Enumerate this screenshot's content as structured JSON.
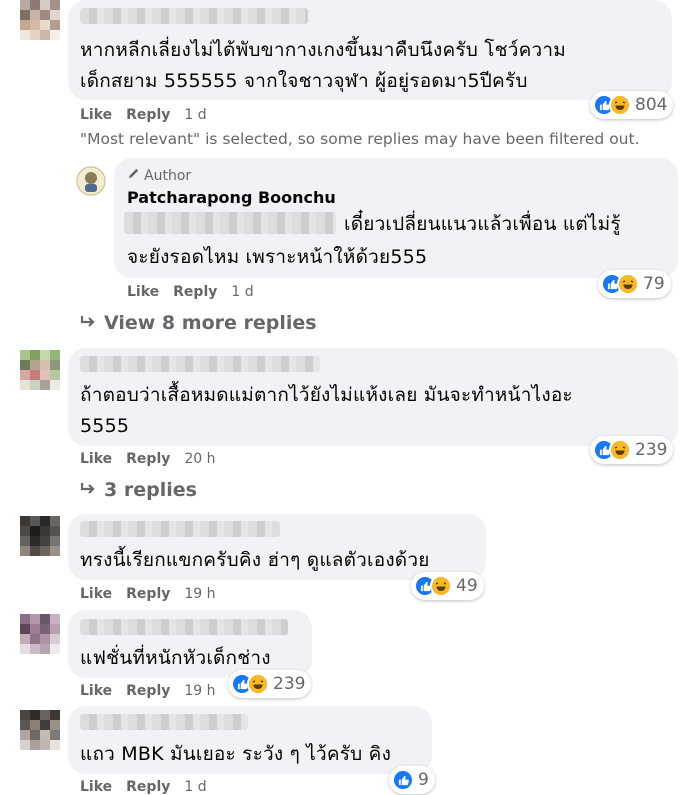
{
  "comments": [
    {
      "text_lines": [
        "หากหลีกเลี่ยงไม่ได้พับขากางเกงขึ้นมาคืบนึงครับ โชว์ความ",
        "เด็กสยาม 555555 จากใจชาวจุฬา ผู้อยู่รอดมา5ปีครับ"
      ],
      "like": "Like",
      "reply": "Reply",
      "time": "1 d",
      "reactions": "804"
    },
    {
      "text_lines": [
        "ถ้าตอบว่าเสื้อหมดแม่ตากไว้ยังไม่แห้งเลย มันจะทำหน้าไงอะ",
        "5555"
      ],
      "like": "Like",
      "reply": "Reply",
      "time": "20 h",
      "reactions": "239"
    },
    {
      "text_lines": [
        "ทรงนี้เรียกแขกครับคิง ฮ่าๆ ดูแลตัวเองด้วย"
      ],
      "like": "Like",
      "reply": "Reply",
      "time": "19 h",
      "reactions": "49"
    },
    {
      "text_lines": [
        "แฟชั่นที่หนักหัวเด็กช่าง"
      ],
      "like": "Like",
      "reply": "Reply",
      "time": "19 h",
      "reactions": "239"
    },
    {
      "text_lines": [
        "แถว MBK มันเยอะ ระวัง ๆ ไว้ครับ คิง"
      ],
      "like": "Like",
      "reply": "Reply",
      "time": "1 d",
      "reactions": "9"
    }
  ],
  "filter_notice": "\"Most relevant\" is selected, so some replies may have been filtered out.",
  "author_reply": {
    "badge": "Author",
    "name": "Patcharapong Boonchu",
    "text_lines": [
      "เดี๋ยวเปลี่ยนแนวแล้วเพื่อน แต่ไม่รู้",
      "จะยังรอดไหม เพราะหน้าให้ด้วย555"
    ],
    "like": "Like",
    "reply": "Reply",
    "time": "1 d",
    "reactions": "79"
  },
  "view_more_replies": "View 8 more replies",
  "replies_link": "3 replies",
  "colors": {
    "like_blue": "#1877f2",
    "haha_yellow": "#f7b928",
    "bubble": "#f0f2f5",
    "meta_gray": "#65676b"
  },
  "icons": [
    "like-icon",
    "haha-icon",
    "pencil-icon",
    "reply-arrow-icon"
  ]
}
